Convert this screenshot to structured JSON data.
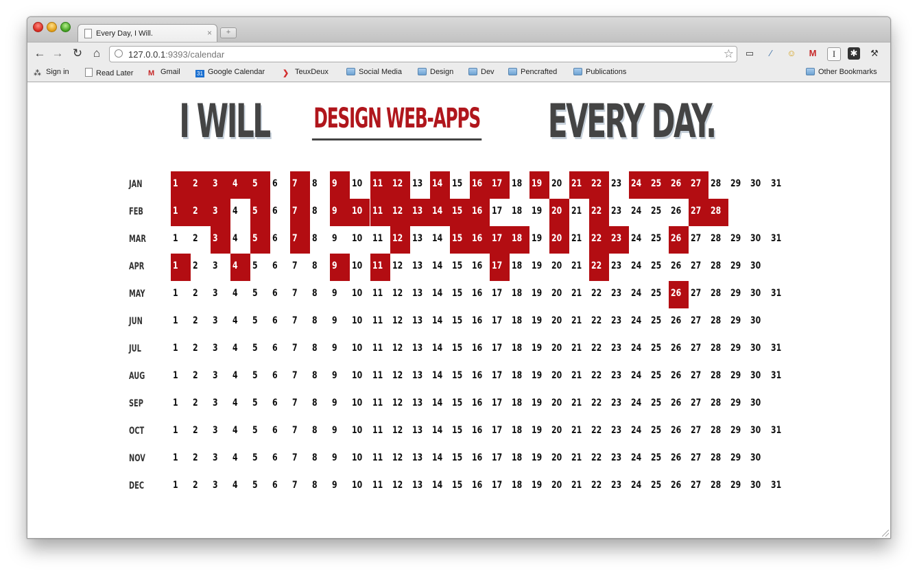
{
  "browser": {
    "tab_title": "Every Day, I Will.",
    "tab_close": "×",
    "new_tab": "+",
    "url_host": "127.0.0.1",
    "url_rest": ":9393/calendar",
    "nav": {
      "back": "←",
      "forward": "→",
      "reload": "↻",
      "home": "⌂"
    },
    "bookmarks": [
      {
        "label": "Sign in"
      },
      {
        "label": "Read Later"
      },
      {
        "label": "Gmail"
      },
      {
        "label": "Google Calendar",
        "badge": "31"
      },
      {
        "label": "TeuxDeux"
      },
      {
        "label": "Social Media"
      },
      {
        "label": "Design"
      },
      {
        "label": "Dev"
      },
      {
        "label": "Pencrafted"
      },
      {
        "label": "Publications"
      }
    ],
    "other_bookmarks": "Other Bookmarks"
  },
  "headline": {
    "left": "I WILL",
    "middle": "DESIGN WEB-APPS",
    "right": "EVERY DAY."
  },
  "colors": {
    "accent": "#b30d12",
    "text_dark": "#444444"
  },
  "calendar": {
    "months": [
      {
        "name": "JAN",
        "days": 31,
        "done": [
          1,
          2,
          3,
          4,
          5,
          7,
          9,
          11,
          12,
          14,
          16,
          17,
          19,
          21,
          22,
          24,
          25,
          26,
          27
        ]
      },
      {
        "name": "FEB",
        "days": 28,
        "done": [
          1,
          2,
          3,
          5,
          7,
          9,
          10,
          11,
          12,
          13,
          14,
          15,
          16,
          20,
          22,
          27,
          28
        ]
      },
      {
        "name": "MAR",
        "days": 31,
        "done": [
          3,
          5,
          7,
          12,
          15,
          16,
          17,
          18,
          20,
          22,
          23,
          26
        ]
      },
      {
        "name": "APR",
        "days": 30,
        "done": [
          1,
          4,
          9,
          11,
          17,
          22
        ]
      },
      {
        "name": "MAY",
        "days": 31,
        "done": [
          26
        ]
      },
      {
        "name": "JUN",
        "days": 30,
        "done": []
      },
      {
        "name": "JUL",
        "days": 31,
        "done": []
      },
      {
        "name": "AUG",
        "days": 31,
        "done": []
      },
      {
        "name": "SEP",
        "days": 30,
        "done": []
      },
      {
        "name": "OCT",
        "days": 31,
        "done": []
      },
      {
        "name": "NOV",
        "days": 30,
        "done": []
      },
      {
        "name": "DEC",
        "days": 31,
        "done": []
      }
    ]
  }
}
